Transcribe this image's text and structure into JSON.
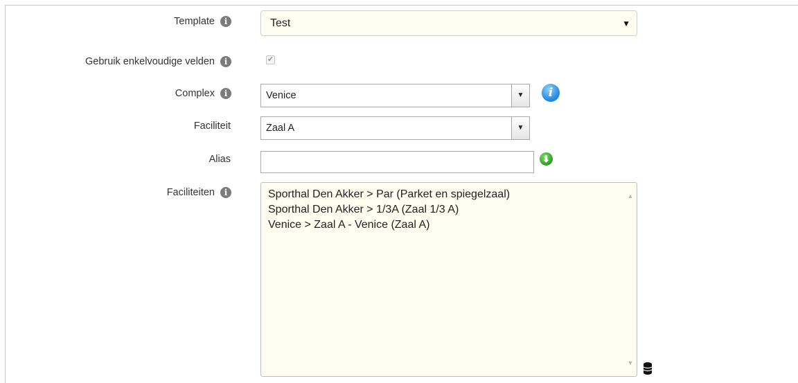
{
  "form": {
    "template": {
      "label": "Template",
      "info_icon": "info-icon",
      "value": "Test"
    },
    "single_fields": {
      "label": "Gebruik enkelvoudige velden",
      "info_icon": "info-icon",
      "checked": true,
      "check_glyph": "✔"
    },
    "complex": {
      "label": "Complex",
      "info_icon": "info-icon",
      "value": "Venice",
      "help_icon": "i"
    },
    "facility": {
      "label": "Faciliteit",
      "value": "Zaal A"
    },
    "alias": {
      "label": "Alias",
      "value": "",
      "add_icon": "green-arrow-down-icon"
    },
    "facilities": {
      "label": "Faciliteiten",
      "info_icon": "info-icon",
      "items": [
        "Sporthal Den Akker > Par (Parket en spiegelzaal)",
        "Sporthal Den Akker > 1/3A (Zaal 1/3 A)",
        "Venice > Zaal A - Venice (Zaal A)"
      ],
      "db_icon": "database-icon"
    }
  },
  "glyphs": {
    "info": "i",
    "caret": "▼",
    "scroll_up": "▲",
    "scroll_down": "▼",
    "arrow": "⬇"
  },
  "colors": {
    "field_bg": "#fffdf0",
    "info_grey": "#7b7b7b",
    "help_blue": "#2a8ee6",
    "add_green": "#2f9b22"
  }
}
